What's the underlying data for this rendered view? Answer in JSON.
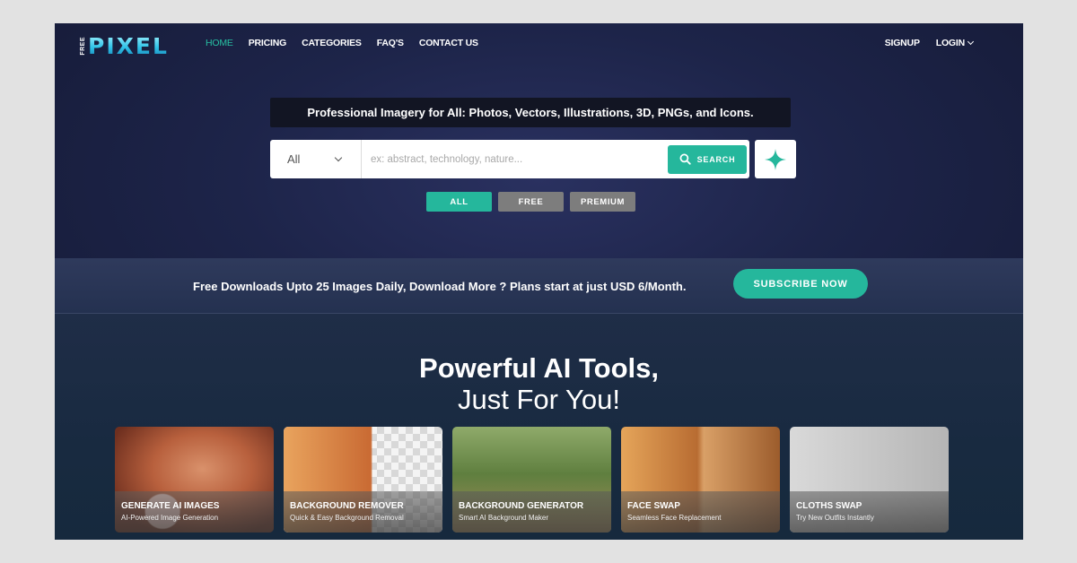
{
  "logo": {
    "free": "FREE",
    "name": "PIXEL"
  },
  "nav": {
    "items": [
      {
        "label": "HOME",
        "active": true
      },
      {
        "label": "PRICING",
        "active": false
      },
      {
        "label": "CATEGORIES",
        "active": false
      },
      {
        "label": "FAQ'S",
        "active": false
      },
      {
        "label": "CONTACT US",
        "active": false
      }
    ],
    "signup": "SIGNUP",
    "login": "LOGIN"
  },
  "hero": {
    "tagline": "Professional Imagery for All: Photos, Vectors, Illustrations, 3D, PNGs, and Icons.",
    "search": {
      "category": "All",
      "placeholder": "ex: abstract, technology, nature...",
      "value": "",
      "button": "SEARCH"
    },
    "filters": [
      "ALL",
      "FREE",
      "PREMIUM"
    ]
  },
  "banner": {
    "text": "Free Downloads Upto 25 Images Daily, Download More ? Plans start at just USD 6/Month.",
    "button": "SUBSCRIBE NOW"
  },
  "tools": {
    "heading": "Powerful AI Tools,",
    "subheading": "Just For You!",
    "cards": [
      {
        "title": "GENERATE AI IMAGES",
        "subtitle": "AI-Powered Image Generation"
      },
      {
        "title": "BACKGROUND REMOVER",
        "subtitle": "Quick & Easy Background Removal"
      },
      {
        "title": "BACKGROUND GENERATOR",
        "subtitle": "Smart AI Background Maker"
      },
      {
        "title": "FACE SWAP",
        "subtitle": "Seamless Face Replacement"
      },
      {
        "title": "CLOTHS SWAP",
        "subtitle": "Try New Outfits Instantly"
      }
    ]
  },
  "colors": {
    "accent": "#25b79c",
    "background": "#1d2449",
    "pill_inactive": "#7d7d7d"
  }
}
